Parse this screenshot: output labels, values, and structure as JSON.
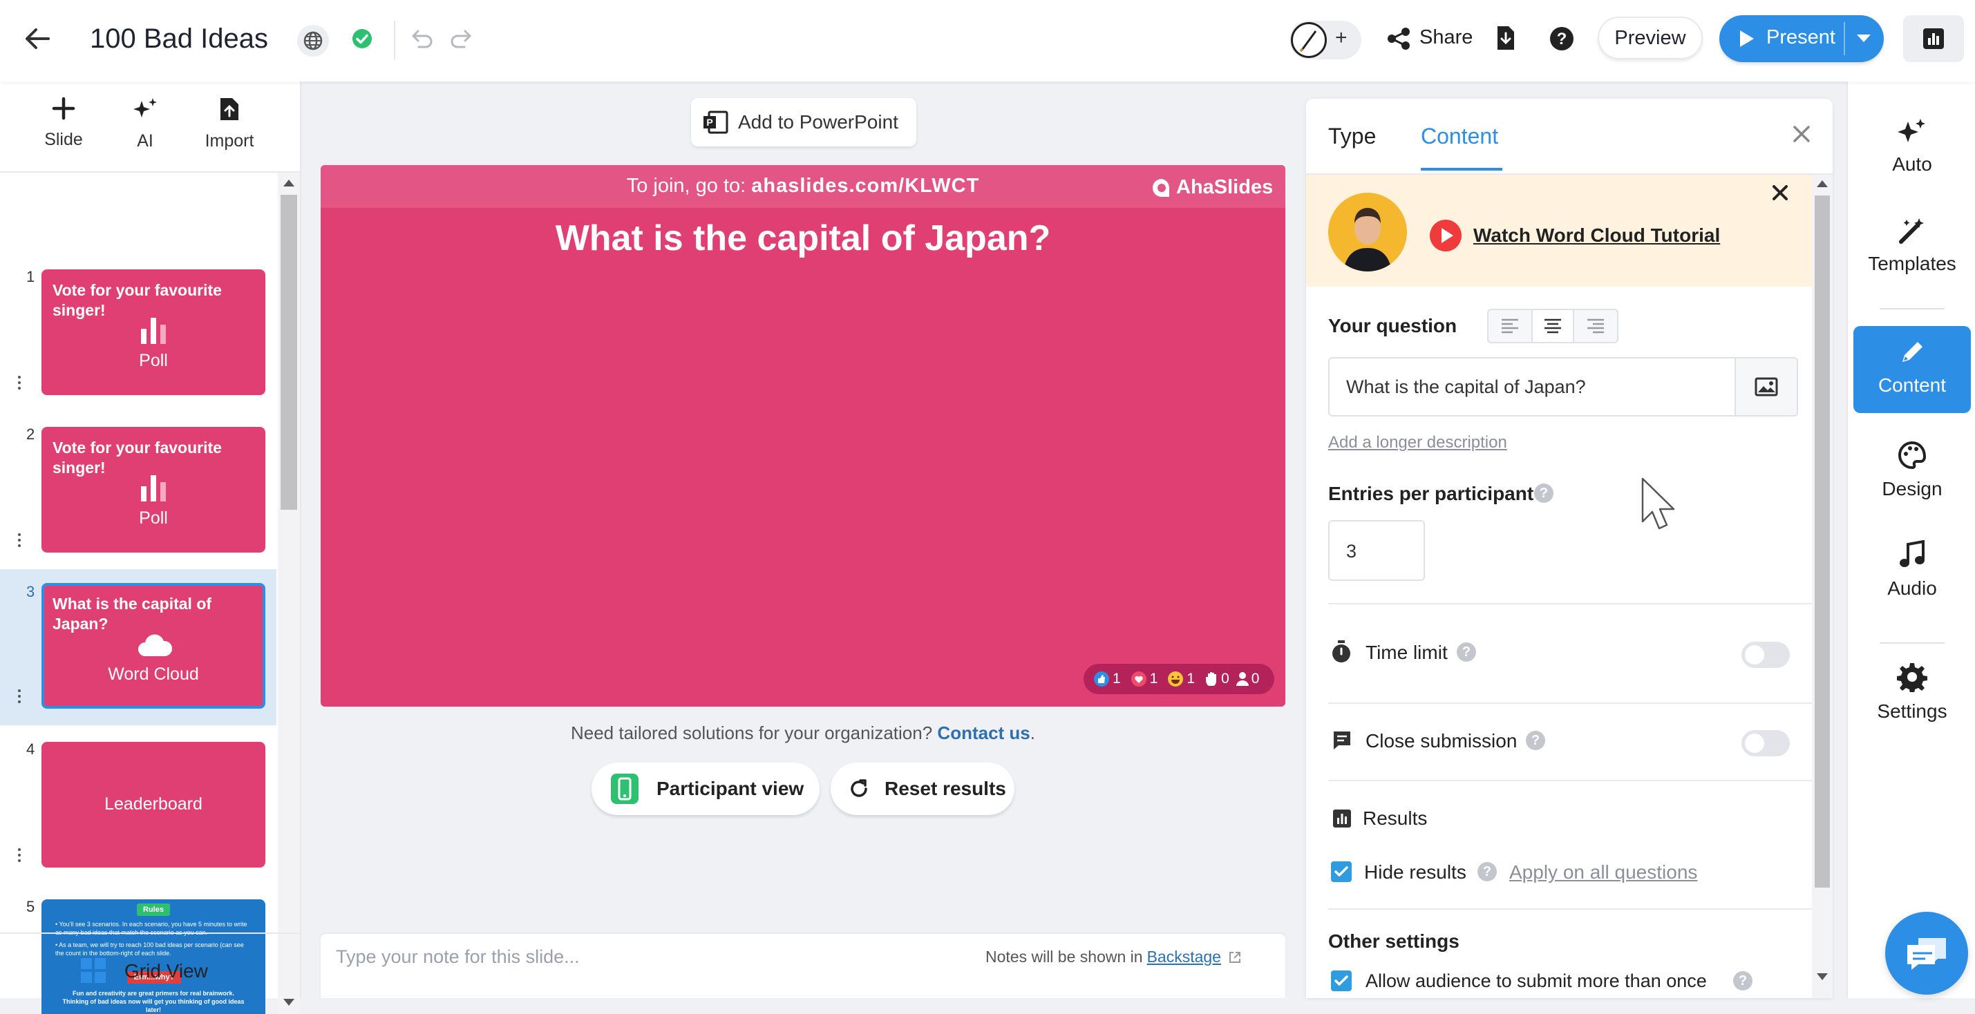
{
  "header": {
    "title": "100 Bad Ideas",
    "share_label": "Share",
    "preview_label": "Preview",
    "present_label": "Present"
  },
  "left_tools": [
    {
      "label": "Slide",
      "icon": "plus-icon"
    },
    {
      "label": "AI",
      "icon": "sparkle-icon"
    },
    {
      "label": "Import",
      "icon": "import-file-icon"
    }
  ],
  "slides": [
    {
      "num": "1",
      "title": "Vote for your favourite singer!",
      "label": "Poll"
    },
    {
      "num": "2",
      "title": "Vote for your favourite singer!",
      "label": "Poll"
    },
    {
      "num": "3",
      "title": "What is the capital of Japan?",
      "label": "Word Cloud"
    },
    {
      "num": "4",
      "title": "",
      "label": "Leaderboard"
    },
    {
      "num": "5",
      "title": "Rules",
      "label": "",
      "lines": [
        "• You'll see 3 scenarios. In each scenario, you have 5 minutes to write as many bad ideas that match the scenario as you can.",
        "• As a team, we will try to reach 100 bad ideas per scenario (can see the count in the bottom-right of each slide.",
        "Erm...why?",
        "Fun and creativity are great primers for real brainwork. Thinking of bad ideas now will get you thinking of good ideas later!"
      ]
    }
  ],
  "grid_view_label": "Grid View",
  "center": {
    "add_to_ppt": "Add to PowerPoint",
    "join_prefix": "To join, go to: ",
    "join_url": "ahaslides.com/KLWCT",
    "brand": "AhaSlides",
    "slide_question": "What is the capital of Japan?",
    "reactions": {
      "like": "1",
      "heart": "1",
      "laugh": "1",
      "hand": "0",
      "people": "0"
    },
    "tailored_text": "Need tailored solutions for your organization?",
    "contact_link": "Contact us",
    "contact_suffix": ".",
    "participant_view": "Participant view",
    "reset_results": "Reset results",
    "note_placeholder": "Type your note for this slide...",
    "notes_shown": "Notes will be shown in",
    "backstage": "Backstage"
  },
  "panel": {
    "tab_type": "Type",
    "tab_content": "Content",
    "tutorial_link": "Watch Word Cloud Tutorial",
    "your_question": "Your question",
    "question_value": "What is the capital of Japan?",
    "add_description": "Add a longer description",
    "entries_label": "Entries per participant",
    "entries_value": "3",
    "time_limit": "Time limit",
    "close_submission": "Close submission",
    "results": "Results",
    "hide_results": "Hide results",
    "apply_all": "Apply on all questions",
    "other_settings": "Other settings",
    "allow_more": "Allow audience to submit more than once"
  },
  "right_rail": [
    {
      "label": "Auto",
      "icon": "auto-sparkle-icon"
    },
    {
      "label": "Templates",
      "icon": "magic-wand-icon"
    },
    {
      "label": "Content",
      "icon": "pencil-icon"
    },
    {
      "label": "Design",
      "icon": "palette-icon"
    },
    {
      "label": "Audio",
      "icon": "music-note-icon"
    },
    {
      "label": "Settings",
      "icon": "gear-icon"
    }
  ],
  "colors": {
    "accent": "#2d8ee6",
    "slide": "#df3f73",
    "tutorial_bg": "#fff3df"
  }
}
